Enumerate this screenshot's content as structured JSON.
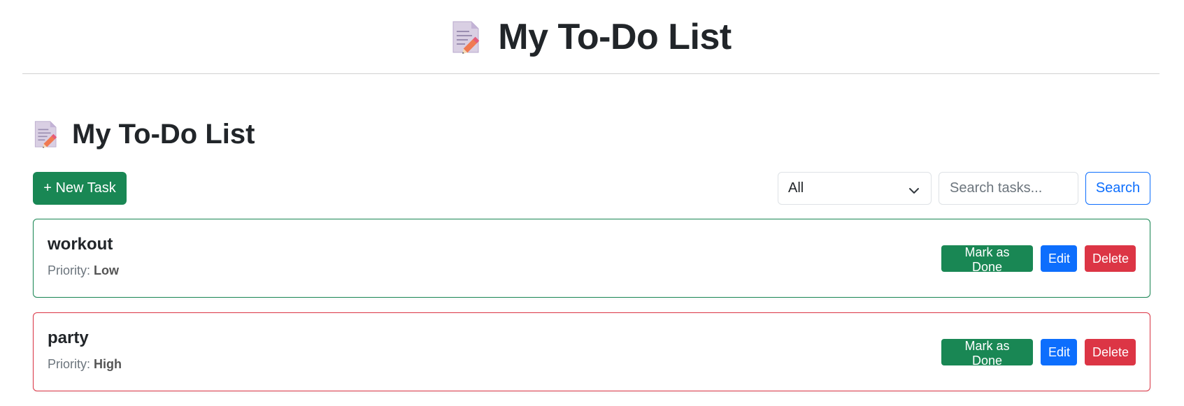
{
  "header": {
    "title": "My To-Do List",
    "icon": "memo-icon"
  },
  "section": {
    "title": "My To-Do List",
    "icon": "memo-icon"
  },
  "toolbar": {
    "new_task_label": "+ New Task",
    "filter": {
      "selected": "All"
    },
    "search": {
      "placeholder": "Search tasks...",
      "value": ""
    },
    "search_button_label": "Search"
  },
  "tasks": [
    {
      "name": "workout",
      "priority_label": "Priority:",
      "priority": "Low",
      "border_color": "#198754",
      "actions": {
        "done": "Mark as Done",
        "edit": "Edit",
        "delete": "Delete"
      }
    },
    {
      "name": "party",
      "priority_label": "Priority:",
      "priority": "High",
      "border_color": "#dc3545",
      "actions": {
        "done": "Mark as Done",
        "edit": "Edit",
        "delete": "Delete"
      }
    }
  ],
  "colors": {
    "success": "#198754",
    "primary": "#0d6efd",
    "danger": "#dc3545"
  }
}
